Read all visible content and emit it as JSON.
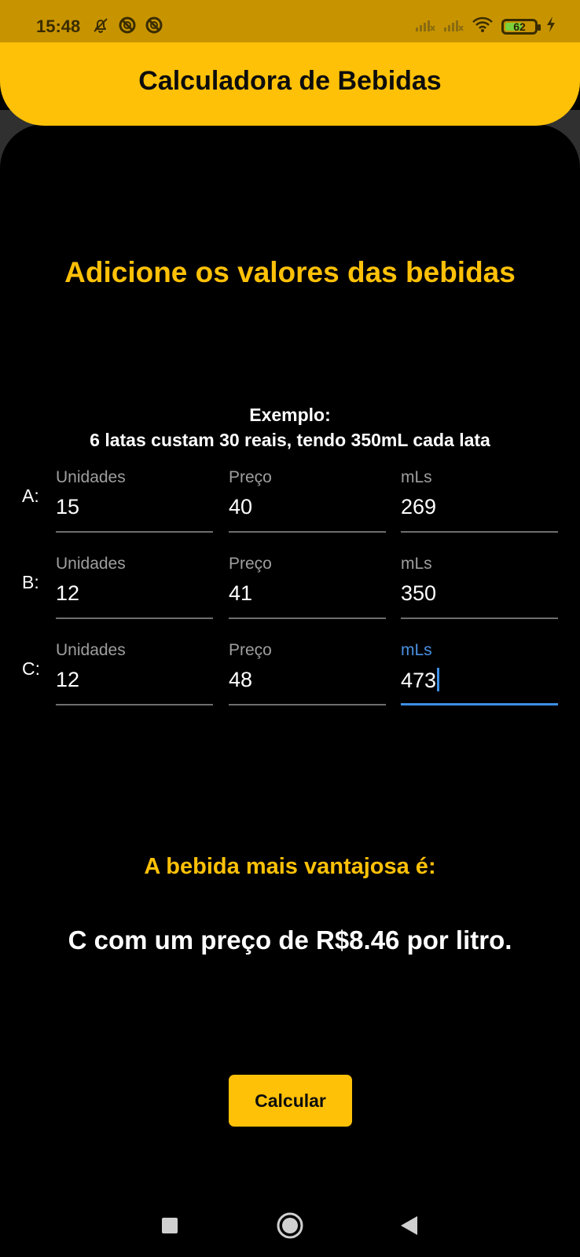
{
  "status_bar": {
    "time": "15:48",
    "battery_level": "62",
    "battery_fraction": 0.62,
    "left_icons": [
      "bell-off-icon",
      "blocked-circle-icon",
      "blocked-circle-icon"
    ],
    "right_icons": [
      "signal-none-icon",
      "signal-none-icon",
      "wifi-icon",
      "battery-icon",
      "charging-bolt-icon"
    ]
  },
  "header": {
    "title": "Calculadora de Bebidas"
  },
  "main": {
    "headline": "Adicione os valores das bebidas",
    "example_title": "Exemplo:",
    "example_text": "6 latas custam 30 reais, tendo 350mL cada lata",
    "rows": [
      {
        "label": "A:",
        "fields": [
          {
            "label": "Unidades",
            "value": "15"
          },
          {
            "label": "Preço",
            "value": "40"
          },
          {
            "label": "mLs",
            "value": "269"
          }
        ]
      },
      {
        "label": "B:",
        "fields": [
          {
            "label": "Unidades",
            "value": "12"
          },
          {
            "label": "Preço",
            "value": "41"
          },
          {
            "label": "mLs",
            "value": "350"
          }
        ]
      },
      {
        "label": "C:",
        "fields": [
          {
            "label": "Unidades",
            "value": "12"
          },
          {
            "label": "Preço",
            "value": "48"
          },
          {
            "label": "mLs",
            "value": "473"
          }
        ]
      }
    ],
    "result_title": "A bebida mais vantajosa é:",
    "result_text": "C com um preço de R$8.46 por litro.",
    "button_label": "Calcular"
  },
  "nav_bar": {
    "icons": [
      "square-recents-icon",
      "circle-home-icon",
      "triangle-back-icon"
    ]
  },
  "colors": {
    "accent": "#ffc107",
    "status_bar": "#c79400",
    "background": "#000000",
    "focus": "#3d8fe6"
  }
}
